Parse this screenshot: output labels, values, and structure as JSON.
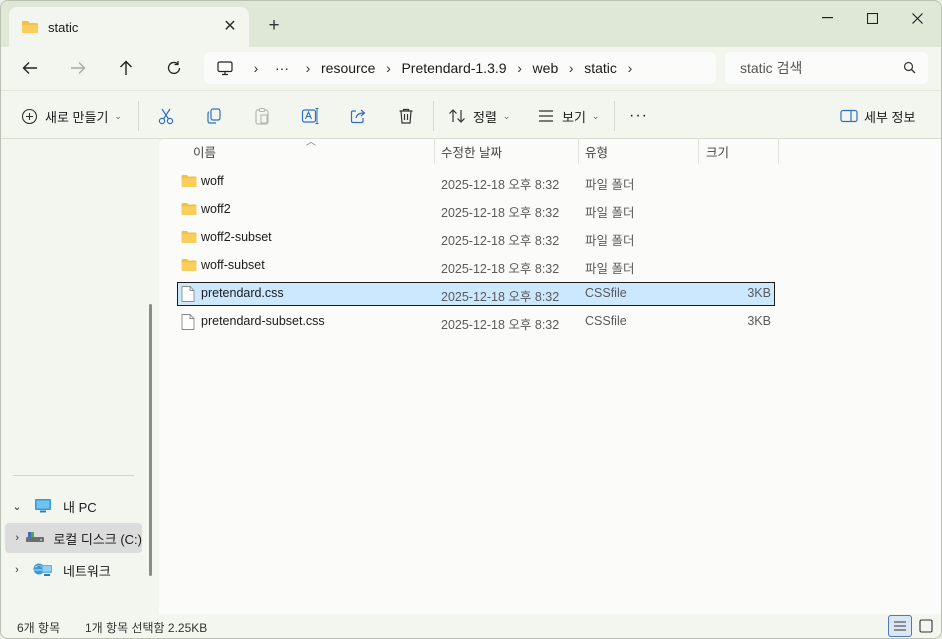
{
  "window": {
    "tab_title": "static",
    "new_tab_icon": "plus-icon"
  },
  "nav": {
    "breadcrumb": [
      "resource",
      "Pretendard-1.3.9",
      "web",
      "static"
    ],
    "overflow_label": "···",
    "search_placeholder": "static 검색"
  },
  "toolbar": {
    "new_label": "새로 만들기",
    "sort_label": "정렬",
    "view_label": "보기",
    "more_label": "···",
    "details_label": "세부 정보"
  },
  "sidebar": {
    "items": [
      {
        "label": "내 PC",
        "icon": "pc-icon",
        "expanded": true
      },
      {
        "label": "로컬 디스크 (C:)",
        "icon": "drive-icon",
        "selected": true
      },
      {
        "label": "네트워크",
        "icon": "network-icon"
      }
    ]
  },
  "columns": [
    "이름",
    "수정한 날짜",
    "유형",
    "크기"
  ],
  "files": [
    {
      "name": "woff",
      "date": "2025-12-18 오후 8:32",
      "type": "파일 폴더",
      "size": "",
      "kind": "folder"
    },
    {
      "name": "woff2",
      "date": "2025-12-18 오후 8:32",
      "type": "파일 폴더",
      "size": "",
      "kind": "folder"
    },
    {
      "name": "woff2-subset",
      "date": "2025-12-18 오후 8:32",
      "type": "파일 폴더",
      "size": "",
      "kind": "folder"
    },
    {
      "name": "woff-subset",
      "date": "2025-12-18 오후 8:32",
      "type": "파일 폴더",
      "size": "",
      "kind": "folder"
    },
    {
      "name": "pretendard.css",
      "date": "2025-12-18 오후 8:32",
      "type": "CSSfile",
      "size": "3KB",
      "kind": "file",
      "selected": true
    },
    {
      "name": "pretendard-subset.css",
      "date": "2025-12-18 오후 8:32",
      "type": "CSSfile",
      "size": "3KB",
      "kind": "file"
    }
  ],
  "status": {
    "count": "6개 항목",
    "selection": "1개 항목 선택함 2.25KB"
  },
  "colors": {
    "folder": "#f3c14b",
    "selection_bg": "#cce8ff",
    "accent": "#2f6fc0"
  }
}
